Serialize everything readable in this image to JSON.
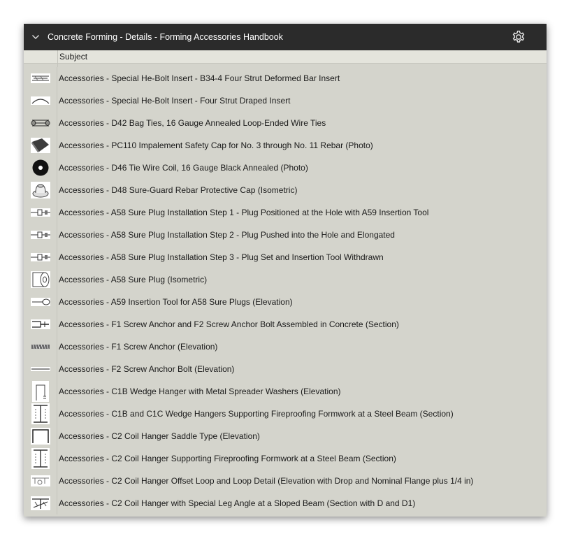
{
  "panel": {
    "title": "Concrete Forming - Details - Forming Accessories Handbook",
    "collapse_icon": "chevron-down-icon",
    "settings_icon": "gear-icon"
  },
  "columns": {
    "subject": "Subject"
  },
  "items": [
    {
      "label": "Accessories - Special He-Bolt Insert - B34-4 Four Strut Deformed Bar Insert",
      "icon": "deformed-bar-insert-icon"
    },
    {
      "label": "Accessories - Special He-Bolt Insert - Four Strut Draped Insert",
      "icon": "draped-insert-icon"
    },
    {
      "label": "Accessories - D42 Bag Ties, 16 Gauge Annealed Loop-Ended Wire Ties",
      "icon": "bag-ties-icon"
    },
    {
      "label": "Accessories - PC110 Impalement Safety Cap for No. 3 through No. 11 Rebar (Photo)",
      "icon": "safety-cap-photo-icon"
    },
    {
      "label": "Accessories - D46 Tie Wire Coil, 16 Gauge Black Annealed (Photo)",
      "icon": "wire-coil-photo-icon"
    },
    {
      "label": "Accessories - D48 Sure-Guard Rebar Protective Cap (Isometric)",
      "icon": "protective-cap-icon"
    },
    {
      "label": "Accessories - A58 Sure Plug Installation Step 1 - Plug Positioned at the Hole with A59 Insertion Tool",
      "icon": "plug-step-icon"
    },
    {
      "label": "Accessories - A58 Sure Plug Installation Step 2 - Plug Pushed into the Hole and Elongated",
      "icon": "plug-step-icon"
    },
    {
      "label": "Accessories - A58 Sure Plug Installation Step 3 - Plug Set and Insertion Tool Withdrawn",
      "icon": "plug-step-icon"
    },
    {
      "label": "Accessories - A58 Sure Plug (Isometric)",
      "icon": "sure-plug-icon"
    },
    {
      "label": "Accessories - A59 Insertion Tool for A58 Sure Plugs (Elevation)",
      "icon": "insertion-tool-icon"
    },
    {
      "label": "Accessories - F1 Screw Anchor and F2 Screw Anchor Bolt Assembled in Concrete (Section)",
      "icon": "screw-anchor-assembly-icon"
    },
    {
      "label": "Accessories - F1 Screw Anchor (Elevation)",
      "icon": "screw-anchor-icon"
    },
    {
      "label": "Accessories - F2 Screw Anchor Bolt (Elevation)",
      "icon": "anchor-bolt-icon"
    },
    {
      "label": "Accessories - C1B Wedge Hanger with Metal Spreader Washers (Elevation)",
      "icon": "wedge-hanger-icon"
    },
    {
      "label": "Accessories - C1B and C1C Wedge Hangers Supporting Fireproofing Formwork at a Steel Beam (Section)",
      "icon": "steel-beam-section-icon"
    },
    {
      "label": "Accessories - C2 Coil Hanger Saddle Type (Elevation)",
      "icon": "saddle-hanger-icon"
    },
    {
      "label": "Accessories - C2 Coil Hanger Supporting Fireproofing Formwork at a Steel Beam (Section)",
      "icon": "steel-beam-section-icon"
    },
    {
      "label": "Accessories - C2 Coil Hanger Offset Loop and Loop Detail (Elevation with Drop and Nominal Flange plus 1/4 in)",
      "icon": "offset-loop-icon"
    },
    {
      "label": "Accessories - C2 Coil Hanger with Special Leg Angle at a Sloped Beam (Section with D and D1)",
      "icon": "sloped-beam-icon"
    }
  ]
}
